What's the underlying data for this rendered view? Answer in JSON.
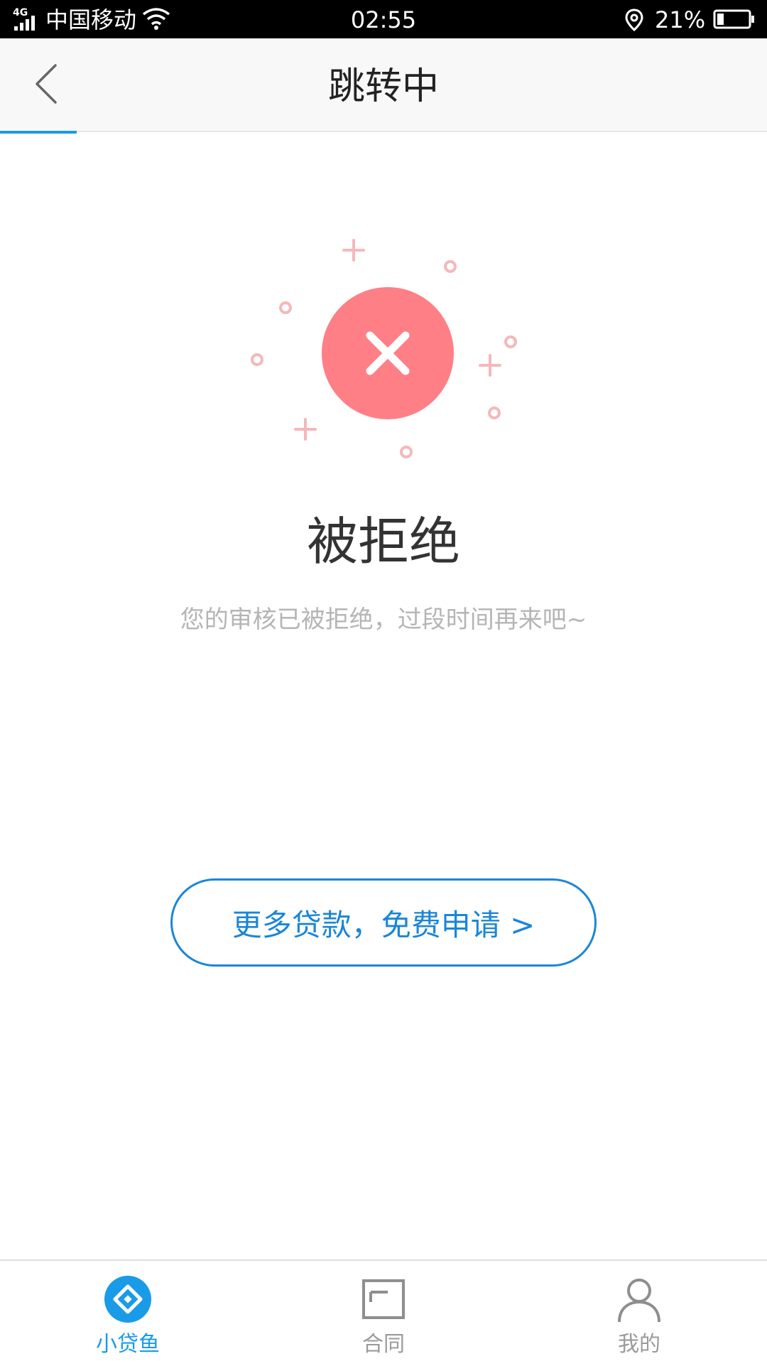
{
  "status_bar": {
    "network": "4G",
    "carrier": "中国移动",
    "time": "02:55",
    "battery_percent": "21%",
    "battery_level": 0.21
  },
  "nav": {
    "title": "跳转中",
    "back_icon": "chevron-left-icon",
    "progress_color": "#1a9be8"
  },
  "result": {
    "status_icon": "rejected-x-icon",
    "title": "被拒绝",
    "description": "您的审核已被拒绝，过段时间再来吧~"
  },
  "cta": {
    "label": "更多贷款，免费申请 >"
  },
  "tabs": [
    {
      "label": "小贷鱼",
      "icon": "diamond-logo-icon",
      "active": true
    },
    {
      "label": "合同",
      "icon": "document-icon",
      "active": false
    },
    {
      "label": "我的",
      "icon": "person-icon",
      "active": false
    }
  ],
  "colors": {
    "accent": "#1a86d8",
    "reject_red": "#ff7f86",
    "decor_pink": "#f4b8bc",
    "tab_active": "#1a9be8",
    "tab_inactive": "#9a9a9a"
  }
}
